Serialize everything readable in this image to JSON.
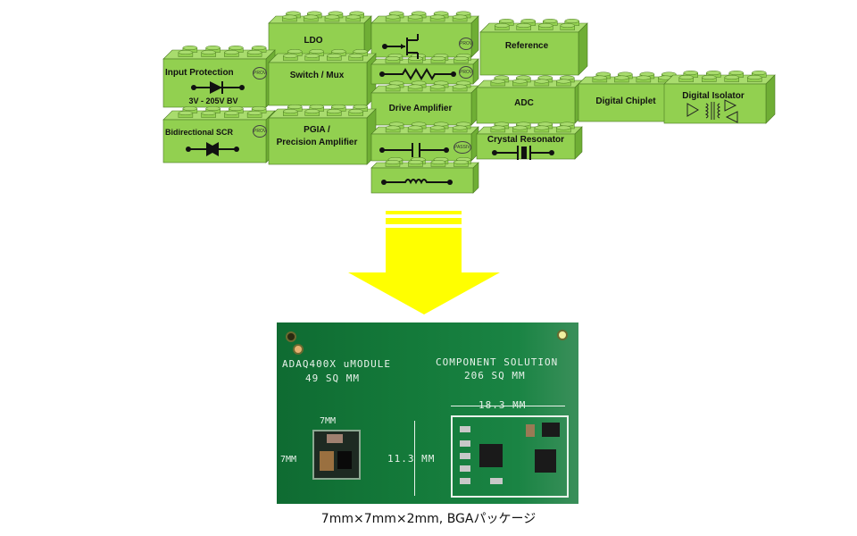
{
  "bricks": {
    "ldo": {
      "label": "LDO"
    },
    "jfet": {
      "label": "",
      "symbol": "jfet-symbol",
      "logo": "PROVEN"
    },
    "reference": {
      "label": "Reference"
    },
    "input_protection": {
      "label": "Input Protection",
      "sublabel": "3V - 205V BV",
      "symbol": "diode-symbol",
      "logo": "PROVEN"
    },
    "switch_mux": {
      "label": "Switch / Mux"
    },
    "resistor": {
      "label": "",
      "symbol": "resistor-symbol",
      "logo": "PROVEN"
    },
    "drive_amplifier": {
      "label": "Drive Amplifier"
    },
    "adc": {
      "label": "ADC"
    },
    "digital_chiplet": {
      "label": "Digital Chiplet"
    },
    "digital_isolator": {
      "label": "Digital Isolator",
      "symbol": "isolator-symbol"
    },
    "bidirectional_scr": {
      "label": "Bidirectional SCR",
      "symbol": "scr-symbol",
      "logo": "PROVEN"
    },
    "pgia": {
      "label_line1": "PGIA /",
      "label_line2": "Precision Amplifier"
    },
    "capacitor": {
      "label": "",
      "symbol": "capacitor-symbol",
      "logo": "PASSIVES"
    },
    "crystal_resonator": {
      "label": "Crystal Resonator",
      "symbol": "crystal-symbol"
    },
    "inductor": {
      "label": "",
      "symbol": "inductor-symbol"
    }
  },
  "arrow": {
    "color": "#ffff00",
    "direction": "down"
  },
  "board": {
    "left_title_line1": "ADAQ400X uMODULE",
    "left_title_line2": "49 SQ MM",
    "right_title_line1": "COMPONENT SOLUTION",
    "right_title_line2": "206 SQ MM",
    "module_width": "7MM",
    "module_height": "7MM",
    "solution_width": "18.3 MM",
    "solution_height": "11.3 MM"
  },
  "caption": "7mm×7mm×2mm, BGAパッケージ",
  "colors": {
    "brick_front": "#92d050",
    "brick_top": "#a9dc6e",
    "brick_side": "#6fae35",
    "arrow": "#ffff00",
    "pcb": "#137a3a"
  }
}
